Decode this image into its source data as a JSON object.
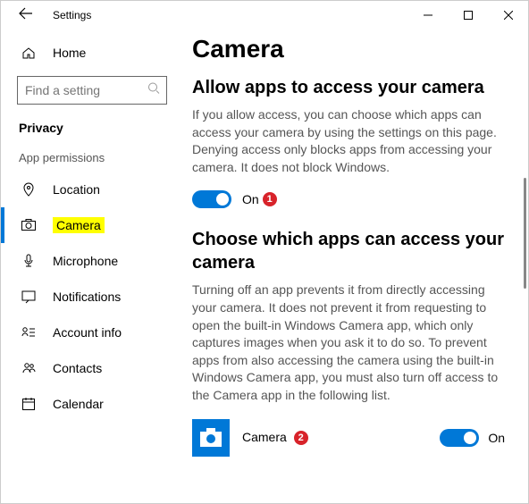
{
  "titlebar": {
    "title": "Settings"
  },
  "sidebar": {
    "home": "Home",
    "search_placeholder": "Find a setting",
    "group": "Privacy",
    "subgroup": "App permissions",
    "items": [
      {
        "label": "Location"
      },
      {
        "label": "Camera"
      },
      {
        "label": "Microphone"
      },
      {
        "label": "Notifications"
      },
      {
        "label": "Account info"
      },
      {
        "label": "Contacts"
      },
      {
        "label": "Calendar"
      }
    ]
  },
  "main": {
    "page_title": "Camera",
    "section1_title": "Allow apps to access your camera",
    "section1_body": "If you allow access, you can choose which apps can access your camera by using the settings on this page. Denying access only blocks apps from accessing your camera. It does not block Windows.",
    "toggle1_state": "On",
    "badge1": "1",
    "section2_title": "Choose which apps can access your camera",
    "section2_body": "Turning off an app prevents it from directly accessing your camera. It does not prevent it from requesting to open the built-in Windows Camera app, which only captures images when you ask it to do so. To prevent apps from also accessing the camera using the built-in Windows Camera app, you must also turn off access to the Camera app in the following list.",
    "app1_name": "Camera",
    "badge2": "2",
    "app1_state": "On"
  }
}
